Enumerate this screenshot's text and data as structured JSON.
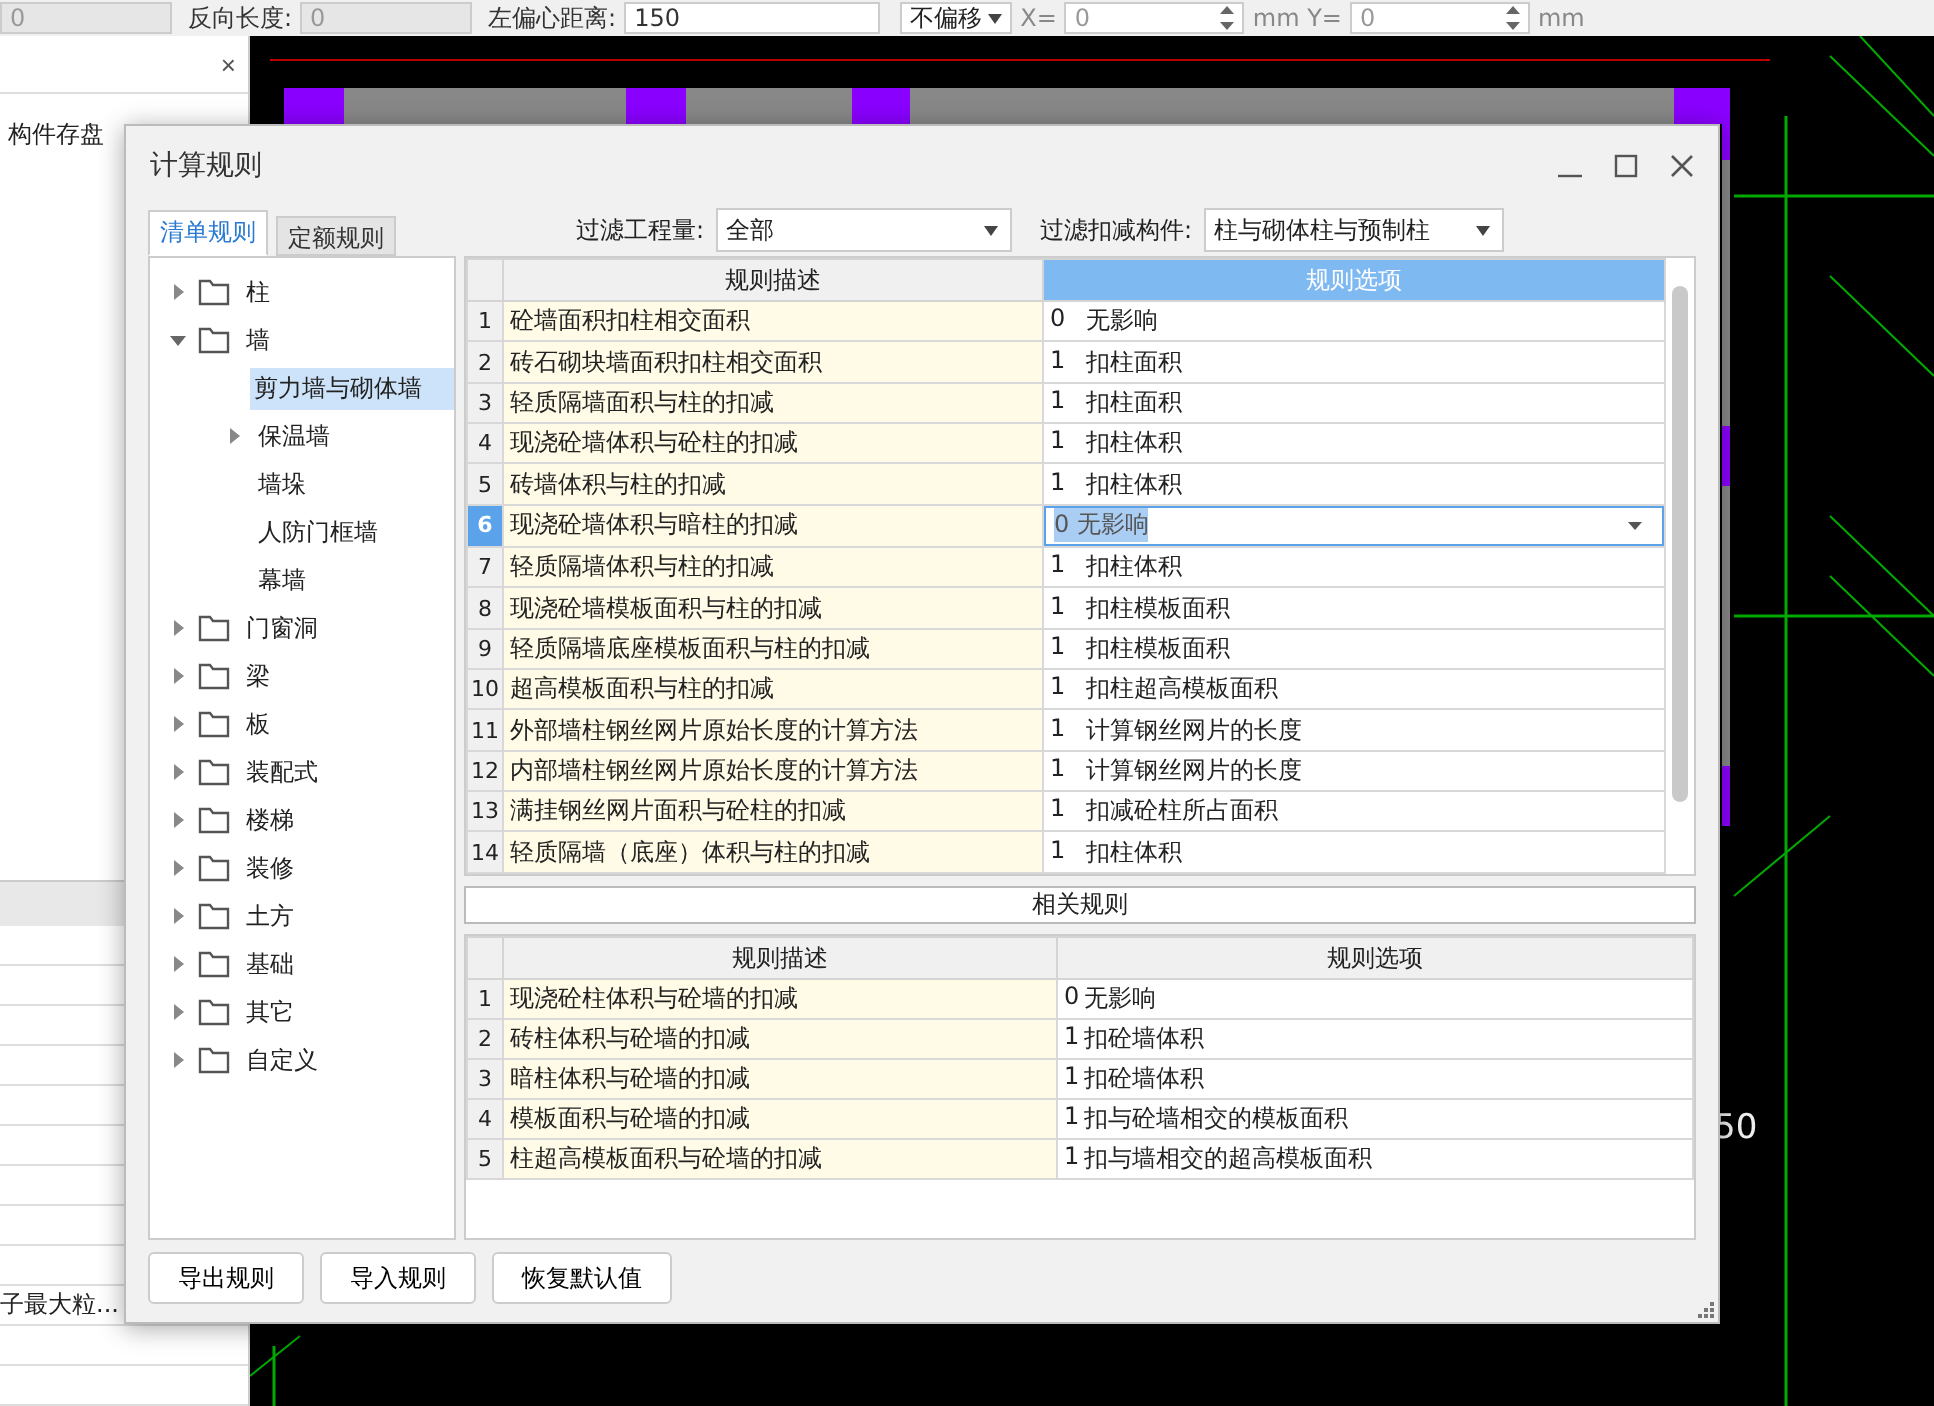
{
  "toolbar": {
    "fields": [
      {
        "value": "0",
        "disabled": true
      },
      {
        "label": "反向长度:",
        "value": "0",
        "disabled": true
      },
      {
        "label": "左偏心距离:",
        "value": "150",
        "disabled": false
      }
    ],
    "offset_select": "不偏移",
    "x_label": "X=",
    "x_value": "0",
    "y_label": "mm Y=",
    "y_value": "0",
    "unit": "mm"
  },
  "side_panel": {
    "close": "×",
    "title": "构件存盘",
    "truncated_item": "子最大粒..."
  },
  "canvas": {
    "dimension": "50"
  },
  "dialog": {
    "title": "计算规则",
    "tabs": [
      {
        "label": "清单规则",
        "selected": true
      },
      {
        "label": "定额规则",
        "selected": false
      }
    ],
    "filters": [
      {
        "label": "过滤工程量:",
        "value": "全部"
      },
      {
        "label": "过滤扣减构件:",
        "value": "柱与砌体柱与预制柱"
      }
    ],
    "tree": [
      {
        "label": "柱",
        "expanded": false,
        "selected": false
      },
      {
        "label": "墙",
        "expanded": true,
        "selected": false,
        "children": [
          {
            "label": "剪力墙与砌体墙",
            "selected": true
          },
          {
            "label": "保温墙",
            "expanded": false,
            "selected": false
          },
          {
            "label": "墙垛",
            "selected": false
          },
          {
            "label": "人防门框墙",
            "selected": false
          },
          {
            "label": "幕墙",
            "selected": false
          }
        ]
      },
      {
        "label": "门窗洞",
        "expanded": false,
        "selected": false
      },
      {
        "label": "梁",
        "expanded": false,
        "selected": false
      },
      {
        "label": "板",
        "expanded": false,
        "selected": false
      },
      {
        "label": "装配式",
        "expanded": false,
        "selected": false
      },
      {
        "label": "楼梯",
        "expanded": false,
        "selected": false
      },
      {
        "label": "装修",
        "expanded": false,
        "selected": false
      },
      {
        "label": "土方",
        "expanded": false,
        "selected": false
      },
      {
        "label": "基础",
        "expanded": false,
        "selected": false
      },
      {
        "label": "其它",
        "expanded": false,
        "selected": false
      },
      {
        "label": "自定义",
        "expanded": false,
        "selected": false
      }
    ],
    "rules_table": {
      "columns": [
        "规则描述",
        "规则选项"
      ],
      "rows": [
        {
          "num": "1",
          "desc": "砼墙面积扣柱相交面积",
          "code": "0",
          "option": "无影响",
          "selected": false
        },
        {
          "num": "2",
          "desc": "砖石砌块墙面积扣柱相交面积",
          "code": "1",
          "option": "扣柱面积",
          "selected": false
        },
        {
          "num": "3",
          "desc": "轻质隔墙面积与柱的扣减",
          "code": "1",
          "option": "扣柱面积",
          "selected": false
        },
        {
          "num": "4",
          "desc": "现浇砼墙体积与砼柱的扣减",
          "code": "1",
          "option": "扣柱体积",
          "selected": false
        },
        {
          "num": "5",
          "desc": "砖墙体积与柱的扣减",
          "code": "1",
          "option": "扣柱体积",
          "selected": false
        },
        {
          "num": "6",
          "desc": "现浇砼墙体积与暗柱的扣减",
          "code": "0",
          "option": "无影响",
          "selected": true
        },
        {
          "num": "7",
          "desc": "轻质隔墙体积与柱的扣减",
          "code": "1",
          "option": "扣柱体积",
          "selected": false
        },
        {
          "num": "8",
          "desc": "现浇砼墙模板面积与柱的扣减",
          "code": "1",
          "option": "扣柱模板面积",
          "selected": false
        },
        {
          "num": "9",
          "desc": "轻质隔墙底座模板面积与柱的扣减",
          "code": "1",
          "option": "扣柱模板面积",
          "selected": false
        },
        {
          "num": "10",
          "desc": "超高模板面积与柱的扣减",
          "code": "1",
          "option": "扣柱超高模板面积",
          "selected": false
        },
        {
          "num": "11",
          "desc": "外部墙柱钢丝网片原始长度的计算方法",
          "code": "1",
          "option": "计算钢丝网片的长度",
          "selected": false
        },
        {
          "num": "12",
          "desc": "内部墙柱钢丝网片原始长度的计算方法",
          "code": "1",
          "option": "计算钢丝网片的长度",
          "selected": false
        },
        {
          "num": "13",
          "desc": "满挂钢丝网片面积与砼柱的扣减",
          "code": "1",
          "option": "扣减砼柱所占面积",
          "selected": false
        },
        {
          "num": "14",
          "desc": "轻质隔墙（底座）体积与柱的扣减",
          "code": "1",
          "option": "扣柱体积",
          "selected": false
        }
      ]
    },
    "related_title": "相关规则",
    "related_table": {
      "columns": [
        "规则描述",
        "规则选项"
      ],
      "rows": [
        {
          "num": "1",
          "desc": "现浇砼柱体积与砼墙的扣减",
          "code": "0",
          "option": "无影响"
        },
        {
          "num": "2",
          "desc": "砖柱体积与砼墙的扣减",
          "code": "1",
          "option": "扣砼墙体积"
        },
        {
          "num": "3",
          "desc": "暗柱体积与砼墙的扣减",
          "code": "1",
          "option": "扣砼墙体积"
        },
        {
          "num": "4",
          "desc": "模板面积与砼墙的扣减",
          "code": "1",
          "option": "扣与砼墙相交的模板面积"
        },
        {
          "num": "5",
          "desc": "柱超高模板面积与砼墙的扣减",
          "code": "1",
          "option": "扣与墙相交的超高模板面积"
        }
      ]
    },
    "buttons": [
      "导出规则",
      "导入规则",
      "恢复默认值"
    ]
  }
}
